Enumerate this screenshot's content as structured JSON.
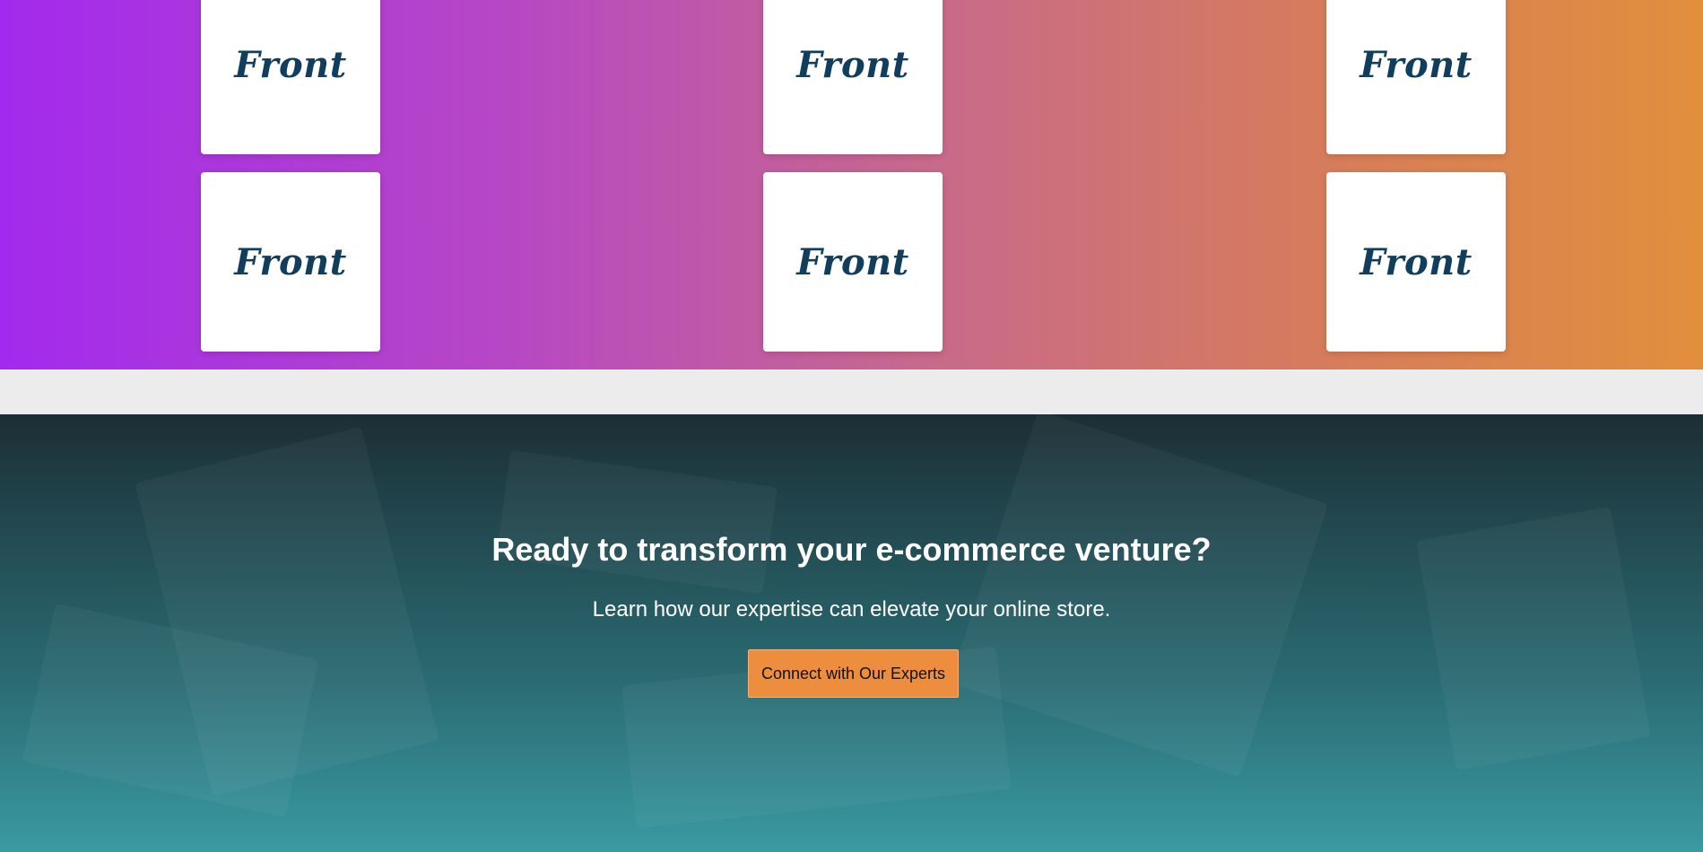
{
  "partner_logos": {
    "items": [
      {
        "label": "Front"
      },
      {
        "label": "Front"
      },
      {
        "label": "Front"
      },
      {
        "label": "Front"
      },
      {
        "label": "Front"
      },
      {
        "label": "Front"
      }
    ],
    "logo_color": "#123e5e",
    "gradient_start": "#a22aee",
    "gradient_end": "#e28f3c"
  },
  "cta": {
    "heading": "Ready to transform your e-commerce venture?",
    "subheading": "Learn how our expertise can elevate your online store.",
    "button_label": "Connect with Our Experts",
    "button_color": "#ec8e3e"
  }
}
